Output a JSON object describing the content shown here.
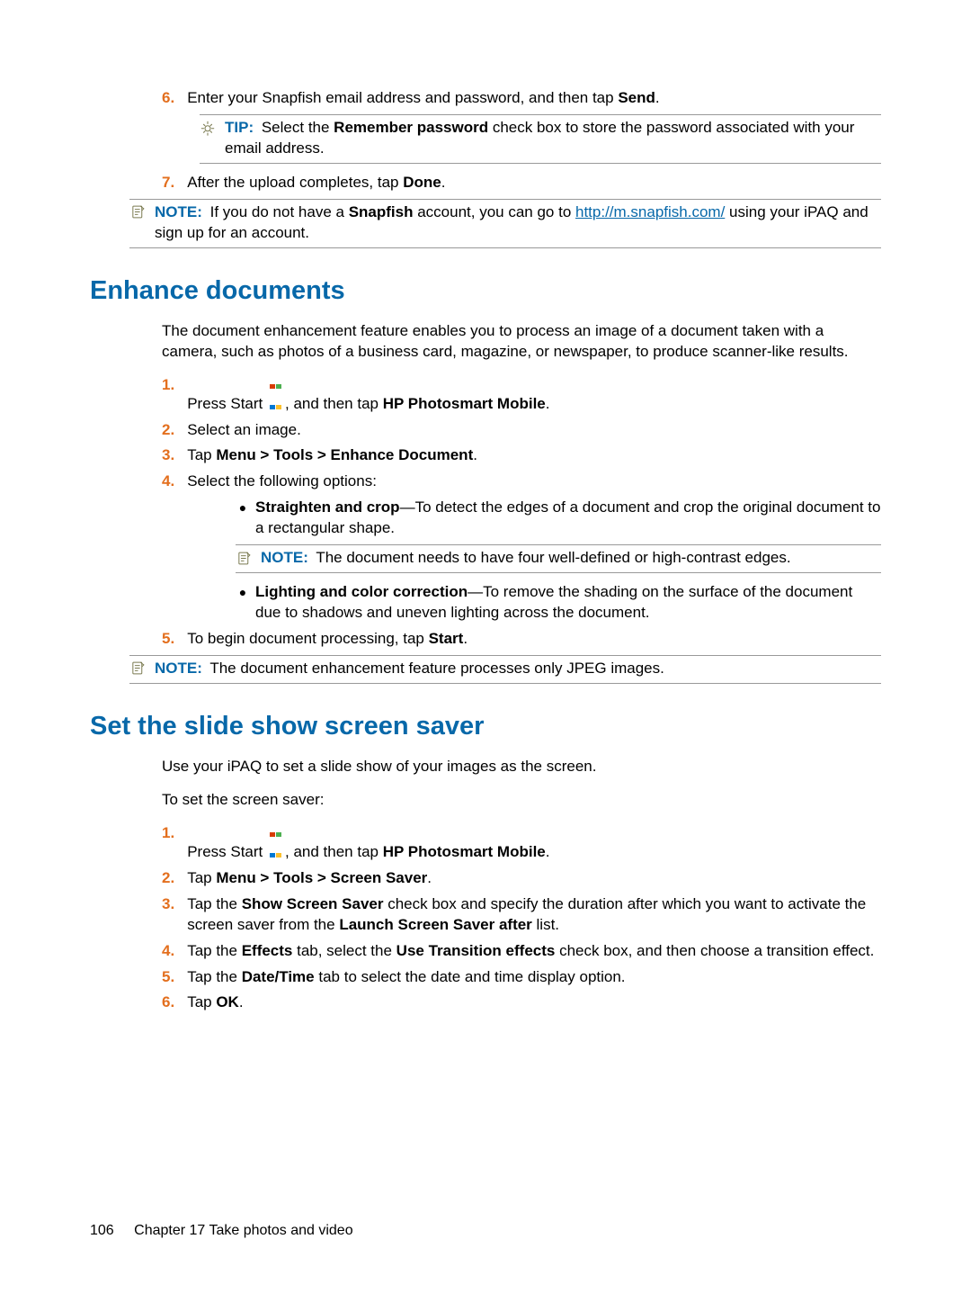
{
  "top": {
    "step6_num": "6.",
    "step6_a": "Enter your Snapfish email address and password, and then tap ",
    "step6_b": "Send",
    "step6_c": ".",
    "tip_label": "TIP:",
    "tip_a": "Select the ",
    "tip_b": "Remember password",
    "tip_c": " check box to store the password associated with your email address.",
    "step7_num": "7.",
    "step7_a": "After the upload completes, tap ",
    "step7_b": "Done",
    "step7_c": ".",
    "note_label": "NOTE:",
    "note_a": "If you do not have a ",
    "note_b": "Snapfish",
    "note_c": " account, you can go to ",
    "note_link": "http://m.snapfish.com/",
    "note_d": " using your iPAQ and sign up for an account."
  },
  "enhance": {
    "heading": "Enhance documents",
    "intro": "The document enhancement feature enables you to process an image of a document taken with a camera, such as photos of a business card, magazine, or newspaper, to produce scanner-like results.",
    "s1_num": "1.",
    "s1_a": "Press Start ",
    "s1_b": ", and then tap ",
    "s1_c": "HP Photosmart Mobile",
    "s1_d": ".",
    "s2_num": "2.",
    "s2": "Select an image.",
    "s3_num": "3.",
    "s3_a": "Tap ",
    "s3_b": "Menu > Tools > Enhance Document",
    "s3_c": ".",
    "s4_num": "4.",
    "s4": "Select the following options:",
    "b1_a": "Straighten and crop",
    "b1_b": "—To detect the edges of a document and crop the original document to a rectangular shape.",
    "b1_note_label": "NOTE:",
    "b1_note": "The document needs to have four well-defined or high-contrast edges.",
    "b2_a": "Lighting and color correction",
    "b2_b": "—To remove the shading on the surface of the document due to shadows and uneven lighting across the document.",
    "s5_num": "5.",
    "s5_a": "To begin document processing, tap ",
    "s5_b": "Start",
    "s5_c": ".",
    "note2_label": "NOTE:",
    "note2": "The document enhancement feature processes only JPEG images."
  },
  "slideshow": {
    "heading": "Set the slide show screen saver",
    "intro": "Use your iPAQ to set a slide show of your images as the screen.",
    "lead": "To set the screen saver:",
    "s1_num": "1.",
    "s1_a": "Press Start ",
    "s1_b": ", and then tap ",
    "s1_c": "HP Photosmart Mobile",
    "s1_d": ".",
    "s2_num": "2.",
    "s2_a": "Tap ",
    "s2_b": "Menu > Tools > Screen Saver",
    "s2_c": ".",
    "s3_num": "3.",
    "s3_a": "Tap the ",
    "s3_b": "Show Screen Saver",
    "s3_c": " check box and specify the duration after which you want to activate the screen saver from the ",
    "s3_d": "Launch Screen Saver after",
    "s3_e": " list.",
    "s4_num": "4.",
    "s4_a": "Tap the ",
    "s4_b": "Effects",
    "s4_c": " tab, select the ",
    "s4_d": "Use Transition effects",
    "s4_e": " check box, and then choose a transition effect.",
    "s5_num": "5.",
    "s5_a": "Tap the ",
    "s5_b": "Date/Time",
    "s5_c": " tab to select the date and time display option.",
    "s6_num": "6.",
    "s6_a": "Tap ",
    "s6_b": "OK",
    "s6_c": "."
  },
  "footer": {
    "page": "106",
    "chapter": "Chapter 17   Take photos and video"
  }
}
